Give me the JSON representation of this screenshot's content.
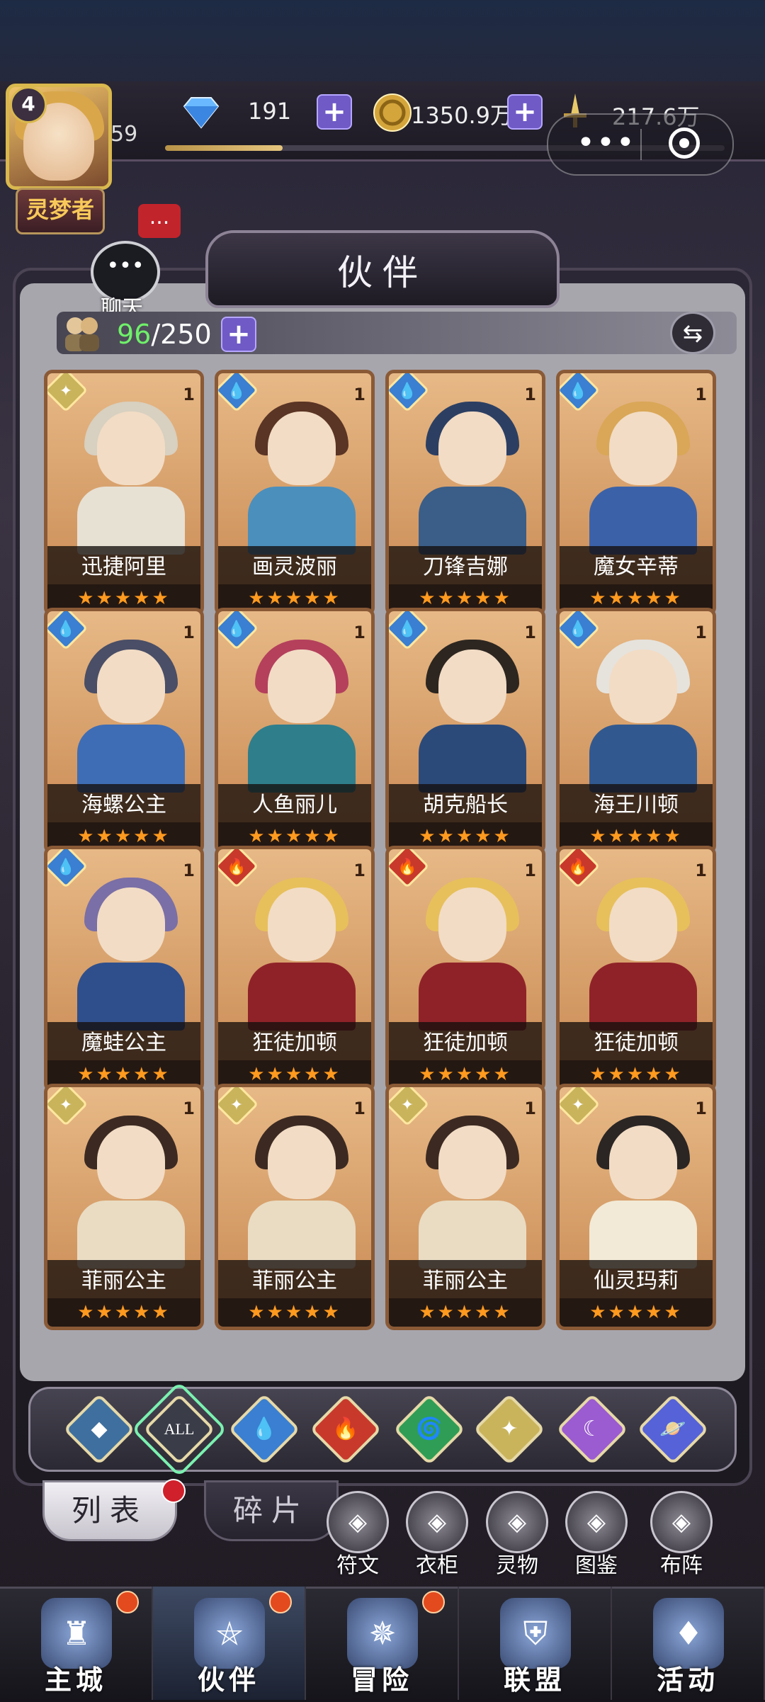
{
  "player": {
    "level": "4",
    "exp_level": "59",
    "title": "灵梦者",
    "exp_progress": 0.21
  },
  "resources": {
    "gems": {
      "icon": "diamond-icon",
      "value": "191"
    },
    "gold": {
      "icon": "gold-coin-icon",
      "value": "1350.9万"
    },
    "power": {
      "icon": "sword-icon",
      "value": "217.6万"
    }
  },
  "capsule": {
    "menu": "•••",
    "close_icon": "target-close-icon"
  },
  "chat": {
    "label": "聊天",
    "badge": "..."
  },
  "panel": {
    "title": "伙伴"
  },
  "partner_count": {
    "current": "96",
    "separator": "/",
    "max": "250"
  },
  "cards": [
    {
      "name": "迅捷阿里",
      "level": "1",
      "element": "light",
      "stars": "★★★★★",
      "hair": "#d8d0c0",
      "outfit": "#e7e1d4"
    },
    {
      "name": "画灵波丽",
      "level": "1",
      "element": "water",
      "stars": "★★★★★",
      "hair": "#5a3424",
      "outfit": "#4b8fbd"
    },
    {
      "name": "刀锋吉娜",
      "level": "1",
      "element": "water",
      "stars": "★★★★★",
      "hair": "#2c3f63",
      "outfit": "#3a5e88"
    },
    {
      "name": "魔女辛蒂",
      "level": "1",
      "element": "water",
      "stars": "★★★★★",
      "hair": "#d9a757",
      "outfit": "#3b62a8"
    },
    {
      "name": "海螺公主",
      "level": "1",
      "element": "water",
      "stars": "★★★★★",
      "hair": "#4a4e66",
      "outfit": "#3e6db5"
    },
    {
      "name": "人鱼丽儿",
      "level": "1",
      "element": "water",
      "stars": "★★★★★",
      "hair": "#b4405c",
      "outfit": "#2f7e8c"
    },
    {
      "name": "胡克船长",
      "level": "1",
      "element": "water",
      "stars": "★★★★★",
      "hair": "#2d2620",
      "outfit": "#2b4a7a"
    },
    {
      "name": "海王川顿",
      "level": "1",
      "element": "water",
      "stars": "★★★★★",
      "hair": "#e6e3dd",
      "outfit": "#32598f"
    },
    {
      "name": "魔蛙公主",
      "level": "1",
      "element": "water",
      "stars": "★★★★★",
      "hair": "#7a6fa6",
      "outfit": "#2f4f8c"
    },
    {
      "name": "狂徒加顿",
      "level": "1",
      "element": "fire",
      "stars": "★★★★★",
      "hair": "#e7c05c",
      "outfit": "#8f2229"
    },
    {
      "name": "狂徒加顿",
      "level": "1",
      "element": "fire",
      "stars": "★★★★★",
      "hair": "#e7c05c",
      "outfit": "#8f2229"
    },
    {
      "name": "狂徒加顿",
      "level": "1",
      "element": "fire",
      "stars": "★★★★★",
      "hair": "#e7c05c",
      "outfit": "#8f2229"
    },
    {
      "name": "菲丽公主",
      "level": "1",
      "element": "light",
      "stars": "★★★★★",
      "hair": "#3c2a22",
      "outfit": "#e9dcc3"
    },
    {
      "name": "菲丽公主",
      "level": "1",
      "element": "light",
      "stars": "★★★★★",
      "hair": "#3c2a22",
      "outfit": "#e9dcc3"
    },
    {
      "name": "菲丽公主",
      "level": "1",
      "element": "light",
      "stars": "★★★★★",
      "hair": "#3c2a22",
      "outfit": "#e9dcc3"
    },
    {
      "name": "仙灵玛莉",
      "level": "1",
      "element": "light",
      "stars": "★★★★★",
      "hair": "#2b2624",
      "outfit": "#f2ead6"
    }
  ],
  "element_colors": {
    "light": "#c9b45c",
    "water": "#3a7fd1",
    "fire": "#c8392c",
    "wind": "#2f9d55",
    "dark": "#9b5bd1",
    "space": "#5562d8",
    "all": "#3a3d48",
    "earth": "#3f6f9e"
  },
  "filters": [
    {
      "name": "filter-earth-icon",
      "label": "",
      "glyph": "◆",
      "color": "#3f6f9e"
    },
    {
      "name": "filter-all-icon",
      "label": "ALL",
      "glyph": "",
      "color": "#3a3d48"
    },
    {
      "name": "filter-water-icon",
      "label": "",
      "glyph": "💧",
      "color": "#3a7fd1"
    },
    {
      "name": "filter-fire-icon",
      "label": "",
      "glyph": "🔥",
      "color": "#c8392c"
    },
    {
      "name": "filter-wind-icon",
      "label": "",
      "glyph": "🌀",
      "color": "#2f9d55"
    },
    {
      "name": "filter-light-icon",
      "label": "",
      "glyph": "✦",
      "color": "#c9b45c"
    },
    {
      "name": "filter-dark-icon",
      "label": "",
      "glyph": "☾",
      "color": "#9b5bd1"
    },
    {
      "name": "filter-space-icon",
      "label": "",
      "glyph": "🪐",
      "color": "#5562d8"
    }
  ],
  "tabs": {
    "list": "列表",
    "shards": "碎片"
  },
  "functions": [
    {
      "label": "符文",
      "icon": "anvil-icon"
    },
    {
      "label": "衣柜",
      "icon": "wardrobe-icon"
    },
    {
      "label": "灵物",
      "icon": "spirit-icon"
    },
    {
      "label": "图鉴",
      "icon": "codex-icon"
    },
    {
      "label": "布阵",
      "icon": "formation-icon"
    }
  ],
  "nav": [
    {
      "label": "主城",
      "icon": "castle-icon",
      "badge": true
    },
    {
      "label": "伙伴",
      "icon": "partner-hat-icon",
      "badge": true
    },
    {
      "label": "冒险",
      "icon": "compass-icon",
      "badge": true
    },
    {
      "label": "联盟",
      "icon": "shield-icon",
      "badge": false
    },
    {
      "label": "活动",
      "icon": "cards-icon",
      "badge": false
    }
  ]
}
